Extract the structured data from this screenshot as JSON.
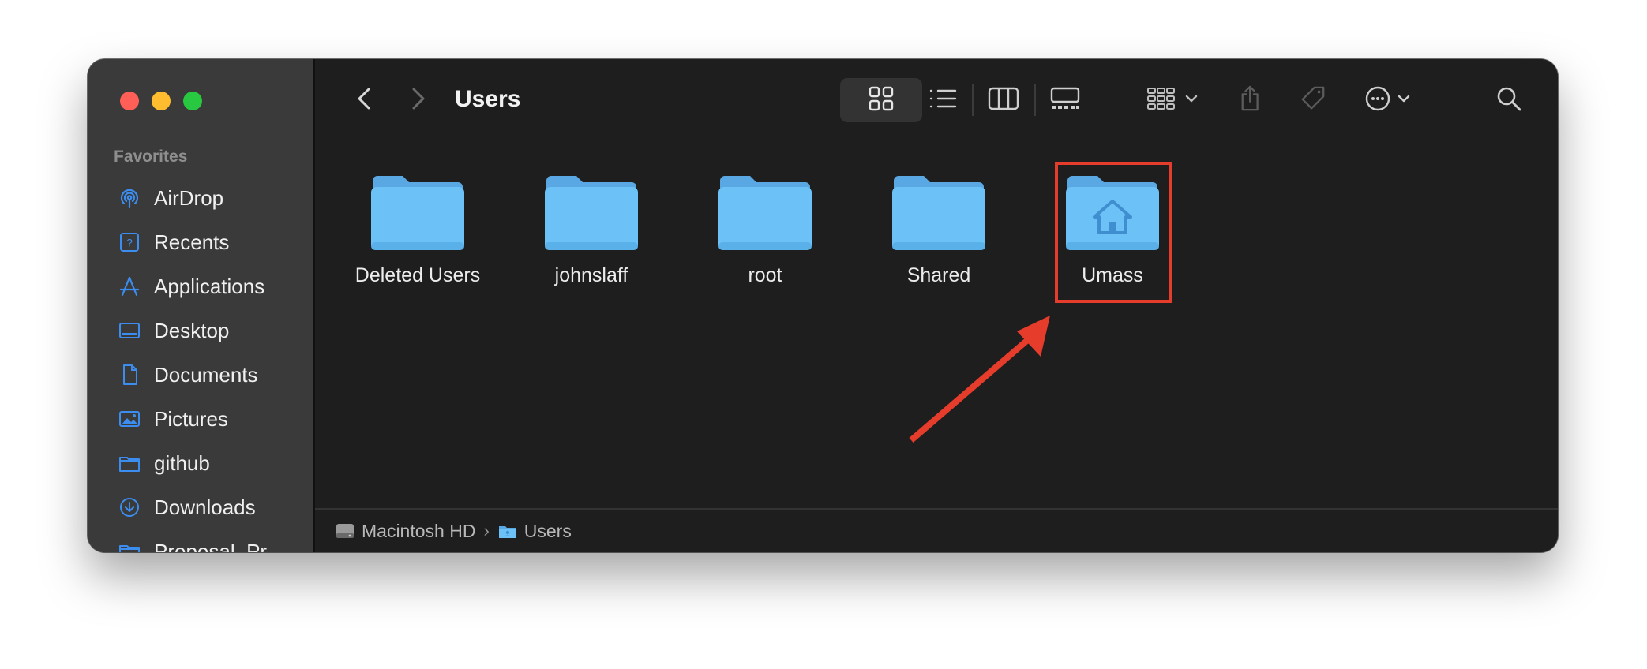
{
  "window": {
    "title": "Users",
    "traffic_lights": {
      "close": "#ff5f57",
      "minimize": "#febc2e",
      "zoom": "#28c840"
    }
  },
  "sidebar": {
    "heading": "Favorites",
    "items": [
      {
        "label": "AirDrop",
        "icon": "airdrop-icon"
      },
      {
        "label": "Recents",
        "icon": "clock-icon"
      },
      {
        "label": "Applications",
        "icon": "applications-icon"
      },
      {
        "label": "Desktop",
        "icon": "desktop-icon"
      },
      {
        "label": "Documents",
        "icon": "document-icon"
      },
      {
        "label": "Pictures",
        "icon": "photo-icon"
      },
      {
        "label": "github",
        "icon": "folder-icon"
      },
      {
        "label": "Downloads",
        "icon": "download-icon"
      },
      {
        "label": "Proposal_Pr",
        "icon": "folder-icon"
      }
    ]
  },
  "toolbar": {
    "icons": [
      "back-icon",
      "forward-icon",
      "icon-view-icon",
      "list-view-icon",
      "column-view-icon",
      "gallery-view-icon",
      "group-icon",
      "share-icon",
      "tag-icon",
      "more-icon",
      "search-icon"
    ],
    "active_view": "icon-view"
  },
  "files": [
    {
      "name": "Deleted Users",
      "icon": "folder-icon"
    },
    {
      "name": "johnslaff",
      "icon": "folder-icon"
    },
    {
      "name": "root",
      "icon": "folder-icon"
    },
    {
      "name": "Shared",
      "icon": "folder-icon"
    },
    {
      "name": "Umass",
      "icon": "home-folder-icon"
    }
  ],
  "pathbar": {
    "segments": [
      {
        "label": "Macintosh HD",
        "icon": "hard-drive-icon"
      },
      {
        "label": "Users",
        "icon": "users-folder-icon"
      }
    ],
    "separator": "›"
  },
  "annotation": {
    "highlight_target": "Umass",
    "color": "#e53c2b"
  },
  "colors": {
    "accent": "#3b8ef0",
    "folder": "#6cc2f6",
    "folder_tab": "#5aa8e3",
    "sidebar_bg": "#3a3a3a",
    "main_bg": "#1e1e1e"
  }
}
